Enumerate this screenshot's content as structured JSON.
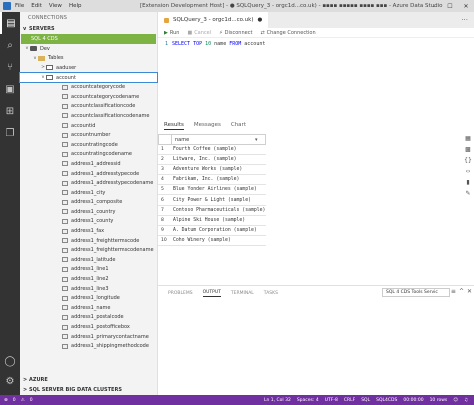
{
  "titlebar": {
    "menu": [
      "File",
      "Edit",
      "View",
      "Help"
    ],
    "window_title": "[Extension Development Host] - ● SQLQuery_3 - orgc1d...co.uk) - ▪▪▪▪ ▪▪▪▪▪ ▪▪▪▪ ▪▪▪ - Azure Data Studio"
  },
  "sidebar": {
    "header": "CONNECTIONS",
    "servers_label": "SERVERS",
    "connection": "SQL 4 CDS",
    "tree": [
      {
        "label": "Dev",
        "level": 1,
        "icon": "db",
        "twisty": "v"
      },
      {
        "label": "Tables",
        "level": 2,
        "icon": "folder",
        "twisty": "v"
      },
      {
        "label": "aaduser",
        "level": 3,
        "icon": "table",
        "twisty": ">"
      },
      {
        "label": "account",
        "level": 3,
        "icon": "table",
        "twisty": "v",
        "selected": true
      }
    ],
    "columns": [
      "accountcategorycode",
      "accountcategorycodename",
      "accountclassificationcode",
      "accountclassificationcodename",
      "accountid",
      "accountnumber",
      "accountratingcode",
      "accountratingcodename",
      "address1_addressid",
      "address1_addresstypecode",
      "address1_addresstypecodename",
      "address1_city",
      "address1_composite",
      "address1_country",
      "address1_county",
      "address1_fax",
      "address1_freighttermscode",
      "address1_freighttermscodename",
      "address1_latitude",
      "address1_line1",
      "address1_line2",
      "address1_line3",
      "address1_longitude",
      "address1_name",
      "address1_postalcode",
      "address1_postofficebox",
      "address1_primarycontactname",
      "address1_shippingmethodcode"
    ],
    "bottom_sections": [
      "AZURE",
      "SQL SERVER BIG DATA CLUSTERS"
    ]
  },
  "editor": {
    "tab_label": "SQLQuery_3 - orgc1d...co.uk)",
    "toolbar": {
      "run": "Run",
      "cancel": "Cancel",
      "disconnect": "Disconnect",
      "change_connection": "Change Connection"
    },
    "code": {
      "line_number": "1",
      "kw1": "SELECT TOP ",
      "num": "10",
      "mid": " name ",
      "kw2": "FROM",
      "tail": " account"
    }
  },
  "results": {
    "tabs": [
      "Results",
      "Messages",
      "Chart"
    ],
    "column_header": "name",
    "rows": [
      {
        "n": "1",
        "v": "Fourth Coffee (sample)"
      },
      {
        "n": "2",
        "v": "Litware, Inc. (sample)"
      },
      {
        "n": "3",
        "v": "Adventure Works (sample)"
      },
      {
        "n": "4",
        "v": "Fabrikam, Inc. (sample)"
      },
      {
        "n": "5",
        "v": "Blue Yonder Airlines (sample)"
      },
      {
        "n": "6",
        "v": "City Power & Light (sample)"
      },
      {
        "n": "7",
        "v": "Contoso Pharmaceuticals (sample)"
      },
      {
        "n": "8",
        "v": "Alpine Ski House (sample)"
      },
      {
        "n": "9",
        "v": "A. Datum Corporation (sample)"
      },
      {
        "n": "10",
        "v": "Coho Winery (sample)"
      }
    ]
  },
  "panel": {
    "tabs": [
      "PROBLEMS",
      "OUTPUT",
      "TERMINAL",
      "TASKS"
    ],
    "active_tab": "OUTPUT",
    "output_select": "SQL 4 CDS Tools Servic"
  },
  "statusbar": {
    "errors": "0",
    "warnings": "0",
    "position": "Ln 1, Col 32",
    "spaces": "Spaces: 4",
    "encoding": "UTF-8",
    "eol": "CRLF",
    "language": "SQL",
    "provider": "SQL4CDS",
    "elapsed": "00:00:00",
    "rows": "10 rows"
  },
  "colors": {
    "connection": "#7cb342",
    "statusbar": "#7030a0",
    "activitybar": "#333333"
  }
}
